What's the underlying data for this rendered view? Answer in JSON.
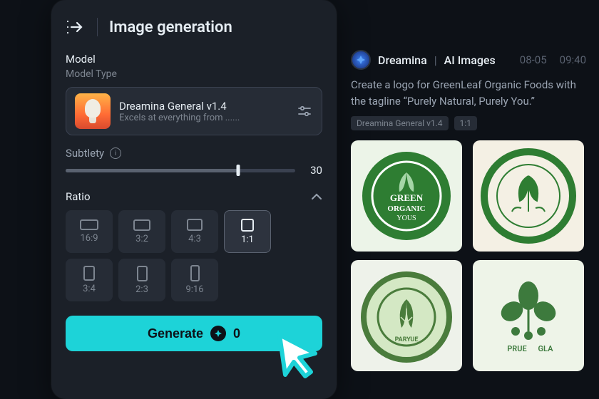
{
  "panel": {
    "title": "Image generation",
    "model_section_label": "Model",
    "model_type_label": "Model Type",
    "model": {
      "name": "Dreamina General v1.4",
      "desc": "Excels at everything from ......"
    },
    "subtlety": {
      "label": "Subtlety",
      "value": "30"
    },
    "ratio": {
      "label": "Ratio",
      "options": [
        "16:9",
        "3:2",
        "4:3",
        "1:1",
        "3:4",
        "2:3",
        "9:16"
      ],
      "selected": "1:1"
    },
    "generate": {
      "label": "Generate",
      "cost": "0"
    }
  },
  "feed": {
    "author": "Dreamina",
    "category": "AI Images",
    "date": "08-05",
    "time": "09:40",
    "prompt": "Create a logo for GreenLeaf Organic Foods with the tagline “Purely Natural, Purely You.”",
    "tags": [
      "Dreamina General v1.4",
      "1:1"
    ]
  }
}
